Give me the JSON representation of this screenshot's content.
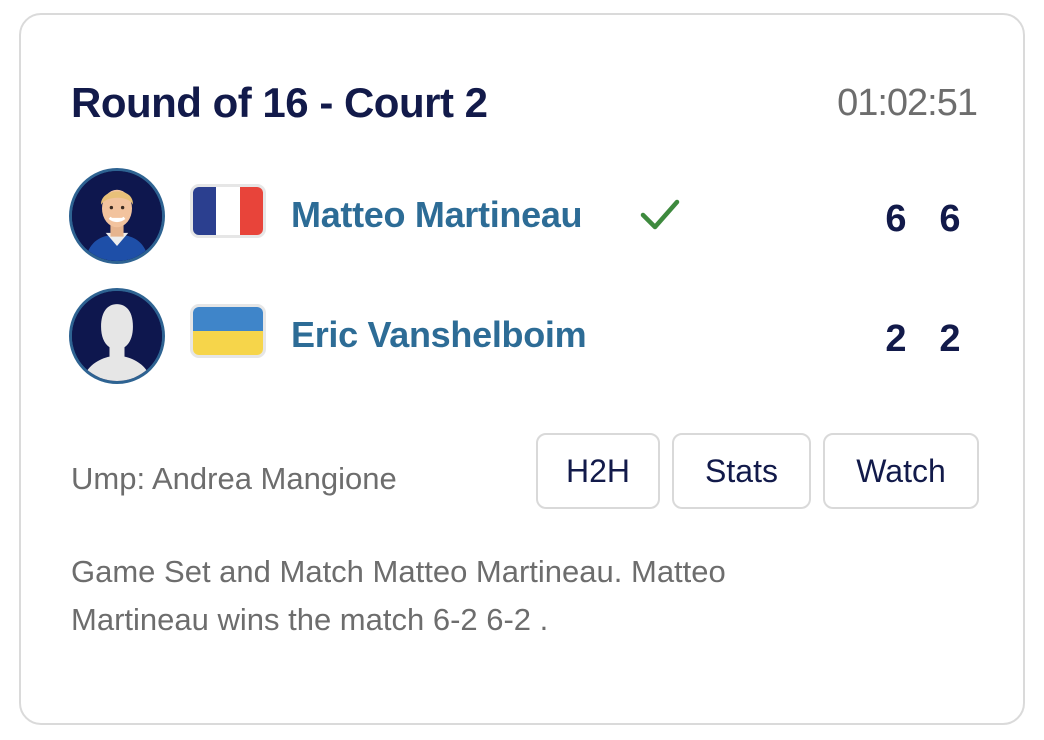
{
  "match": {
    "title": "Round of 16 - Court 2",
    "elapsed_time": "01:02:51"
  },
  "players": [
    {
      "name": "Matteo Martineau",
      "country_flag": "france",
      "flag_colors": [
        "#2b3f8f",
        "#ffffff",
        "#e8443a"
      ],
      "winner": true,
      "winner_icon": "checkmark-icon",
      "winner_color": "#3e8a3e",
      "avatar": "player-photo",
      "set_scores": [
        "6",
        "6"
      ]
    },
    {
      "name": "Eric Vanshelboim",
      "country_flag": "ukraine",
      "flag_colors": [
        "#3f85c9",
        "#f6d54a"
      ],
      "winner": false,
      "avatar": "default-silhouette",
      "set_scores": [
        "2",
        "2"
      ]
    }
  ],
  "umpire": "Ump: Andrea Mangione",
  "buttons": {
    "h2h": "H2H",
    "stats": "Stats",
    "watch": "Watch"
  },
  "summary": "Game Set and Match Matteo Martineau. Matteo Martineau wins the match 6-2 6-2 .",
  "colors": {
    "title": "#121a4a",
    "player_name": "#2d6c96",
    "muted_text": "#6d6d6d",
    "avatar_ring": "#2e6392",
    "border": "#dadada"
  }
}
